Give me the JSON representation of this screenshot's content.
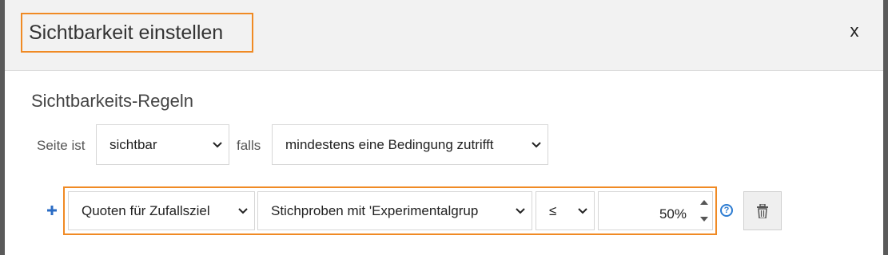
{
  "dialog": {
    "title": "Sichtbarkeit einstellen",
    "close_label": "x",
    "section_title": "Sichtbarkeits-Regeln"
  },
  "visibility": {
    "prefix_label": "Seite ist",
    "state_value": "sichtbar",
    "falls_label": "falls",
    "condition_value": "mindestens eine Bedingung zutrifft"
  },
  "rule": {
    "add_icon": "plus-icon",
    "source_value": "Quoten für Zufallsziel",
    "sample_value": "Stichproben mit 'Experimentalgrup",
    "operator_value": "≤",
    "number_value": "50%",
    "help_glyph": "?",
    "delete_icon": "trash-icon"
  },
  "colors": {
    "highlight": "#f08a24",
    "accent": "#2b6cc4"
  }
}
